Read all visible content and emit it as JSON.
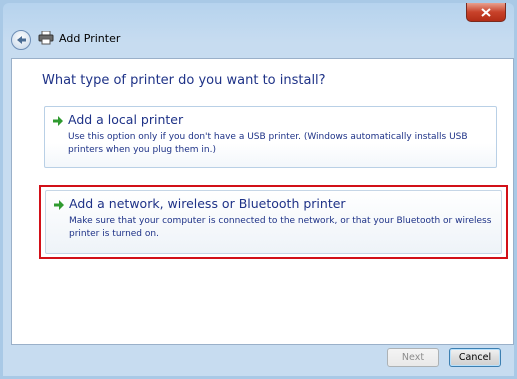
{
  "window": {
    "title": "Add Printer"
  },
  "content": {
    "heading": "What type of printer do you want to install?",
    "options": [
      {
        "title": "Add a local printer",
        "description": "Use this option only if you don't have a USB printer. (Windows automatically installs USB printers when you plug them in.)"
      },
      {
        "title": "Add a network, wireless or Bluetooth printer",
        "description": "Make sure that your computer is connected to the network, or that your Bluetooth or wireless printer is turned on."
      }
    ]
  },
  "buttons": {
    "next": "Next",
    "cancel": "Cancel"
  },
  "colors": {
    "highlight_border": "#d21018",
    "link_text": "#1e3287"
  }
}
